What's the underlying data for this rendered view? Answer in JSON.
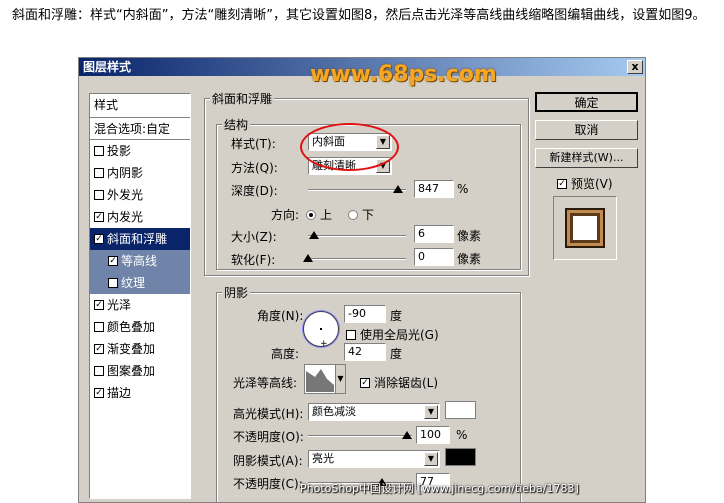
{
  "intro_text": "斜面和浮雕：样式“内斜面”，方法“雕刻清晰”，其它设置如图8，然后点击光泽等高线曲线缩略图编辑曲线，设置如图9。",
  "watermark": "www.68ps.com",
  "dialog": {
    "title": "图层样式",
    "close": "x"
  },
  "left_list": {
    "header": "样式",
    "blend": "混合选项:自定",
    "items": [
      {
        "label": "投影",
        "checked": false
      },
      {
        "label": "内阴影",
        "checked": false
      },
      {
        "label": "外发光",
        "checked": false
      },
      {
        "label": "内发光",
        "checked": true
      },
      {
        "label": "斜面和浮雕",
        "checked": true
      },
      {
        "label": "等高线",
        "checked": true
      },
      {
        "label": "纹理",
        "checked": false
      },
      {
        "label": "光泽",
        "checked": true
      },
      {
        "label": "颜色叠加",
        "checked": false
      },
      {
        "label": "渐变叠加",
        "checked": true
      },
      {
        "label": "图案叠加",
        "checked": false
      },
      {
        "label": "描边",
        "checked": true
      }
    ]
  },
  "bevel": {
    "section": "斜面和浮雕",
    "structure": "结构",
    "style_label": "样式(T):",
    "style_value": "内斜面",
    "technique_label": "方法(Q):",
    "technique_value": "雕刻清晰",
    "depth_label": "深度(D):",
    "depth_value": "847",
    "depth_unit": "%",
    "direction_label": "方向:",
    "dir_up": "上",
    "dir_down": "下",
    "size_label": "大小(Z):",
    "size_value": "6",
    "size_unit": "像素",
    "soften_label": "软化(F):",
    "soften_value": "0",
    "soften_unit": "像素"
  },
  "shading": {
    "section": "阴影",
    "angle_label": "角度(N):",
    "angle_value": "-90",
    "angle_unit": "度",
    "global_light": "使用全局光(G)",
    "altitude_label": "高度:",
    "altitude_value": "42",
    "altitude_unit": "度",
    "gloss_label": "光泽等高线:",
    "anti_alias": "消除锯齿(L)",
    "highlight_label": "高光模式(H):",
    "highlight_value": "颜色减淡",
    "highlight_color": "#ffffff",
    "opacity_label": "不透明度(O):",
    "opacity_value": "100",
    "opacity_unit": "%",
    "shadow_label": "阴影模式(A):",
    "shadow_value": "亮光",
    "shadow_color": "#000000",
    "opacity2_label": "不透明度(C):",
    "opacity2_value": "77"
  },
  "buttons": {
    "ok": "确定",
    "cancel": "取消",
    "new_style": "新建样式(W)...",
    "preview": "预览(V)"
  },
  "footer": "PhotoShop中国设计网 [www.jinecg.com/tieba/1783]"
}
